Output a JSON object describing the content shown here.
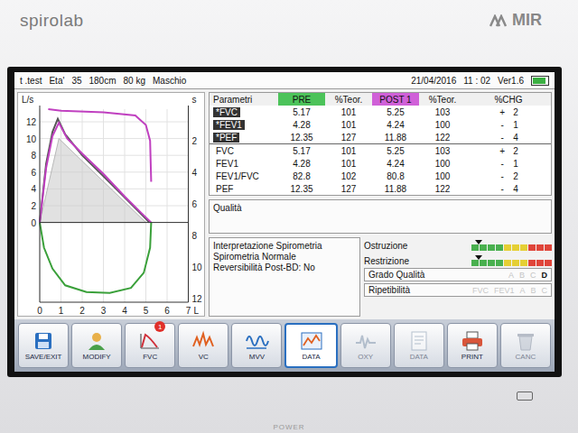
{
  "device": {
    "brand": "spirolab",
    "logo": "MIR",
    "power_label": "POWER"
  },
  "header": {
    "patient": "t .test",
    "age_label": "Eta'",
    "age": "35",
    "height": "180cm",
    "weight": "80 kg",
    "sex": "Maschio",
    "date": "21/04/2016",
    "time": "11 : 02",
    "version": "Ver1.6",
    "battery_level": 0.9
  },
  "chart": {
    "flow_unit": "L/s",
    "time_unit": "s",
    "volume_unit": "L",
    "flow_ticks": [
      "12",
      "10",
      "8",
      "6",
      "4",
      "2",
      "0"
    ],
    "time_ticks": [
      "2",
      "4",
      "6",
      "8",
      "10",
      "12"
    ],
    "volume_ticks": [
      "0",
      "1",
      "2",
      "3",
      "4",
      "5",
      "6",
      "7"
    ],
    "series": [
      {
        "kind": "area",
        "axis": "flow",
        "color": "#c9c9c9",
        "points": [
          [
            0,
            0
          ],
          [
            0.9,
            10
          ],
          [
            5,
            0
          ]
        ]
      },
      {
        "kind": "line",
        "axis": "flow",
        "color": "#555555",
        "points": [
          [
            0,
            0
          ],
          [
            0.3,
            7
          ],
          [
            0.6,
            10.8
          ],
          [
            0.85,
            12.35
          ],
          [
            1.2,
            10.5
          ],
          [
            2,
            8
          ],
          [
            3,
            5.5
          ],
          [
            4,
            3
          ],
          [
            4.7,
            1.2
          ],
          [
            5.17,
            0
          ]
        ]
      },
      {
        "kind": "line",
        "axis": "flow",
        "color": "#c040c0",
        "points": [
          [
            0,
            0
          ],
          [
            0.3,
            6.5
          ],
          [
            0.6,
            10.3
          ],
          [
            0.9,
            11.88
          ],
          [
            1.3,
            10
          ],
          [
            2,
            8.2
          ],
          [
            3,
            5.8
          ],
          [
            4,
            3.1
          ],
          [
            4.8,
            1.1
          ],
          [
            5.25,
            0
          ]
        ]
      },
      {
        "kind": "line",
        "axis": "flow",
        "color": "#3aa03a",
        "points": [
          [
            5.25,
            0
          ],
          [
            5.2,
            -3
          ],
          [
            4.9,
            -6
          ],
          [
            4.3,
            -7.8
          ],
          [
            3.3,
            -8.4
          ],
          [
            2.2,
            -8.3
          ],
          [
            1.2,
            -7.5
          ],
          [
            0.6,
            -5.5
          ],
          [
            0.2,
            -3
          ],
          [
            0,
            0
          ]
        ]
      },
      {
        "kind": "line",
        "axis": "time",
        "color": "#c040c0",
        "points": [
          [
            0.4,
            0
          ],
          [
            1,
            0.1
          ],
          [
            3,
            0.2
          ],
          [
            4.5,
            0.4
          ],
          [
            5,
            1
          ],
          [
            5.2,
            2
          ],
          [
            5.25,
            4.6
          ]
        ]
      }
    ]
  },
  "table": {
    "columns": [
      {
        "label": "Parametri",
        "color": ""
      },
      {
        "label": "PRE",
        "color": "#4cc35a"
      },
      {
        "label": "%Teor.",
        "color": ""
      },
      {
        "label": "POST 1",
        "color": "#d060d8"
      },
      {
        "label": "%Teor.",
        "color": ""
      },
      {
        "label": "%CHG",
        "color": ""
      }
    ],
    "rows": [
      {
        "param": "*FVC",
        "highlighted": true,
        "pre": "5.17",
        "pre_pct": "101",
        "post": "5.25",
        "post_pct": "103",
        "sign": "+",
        "chg": "2"
      },
      {
        "param": "*FEV1",
        "highlighted": true,
        "pre": "4.28",
        "pre_pct": "101",
        "post": "4.24",
        "post_pct": "100",
        "sign": "-",
        "chg": "1"
      },
      {
        "param": "*PEF",
        "highlighted": true,
        "pre": "12.35",
        "pre_pct": "127",
        "post": "11.88",
        "post_pct": "122",
        "sign": "-",
        "chg": "4"
      },
      {
        "param": "FVC",
        "highlighted": false,
        "pre": "5.17",
        "pre_pct": "101",
        "post": "5.25",
        "post_pct": "103",
        "sign": "+",
        "chg": "2"
      },
      {
        "param": "FEV1",
        "highlighted": false,
        "pre": "4.28",
        "pre_pct": "101",
        "post": "4.24",
        "post_pct": "100",
        "sign": "-",
        "chg": "1"
      },
      {
        "param": "FEV1/FVC",
        "highlighted": false,
        "pre": "82.8",
        "pre_pct": "102",
        "post": "80.8",
        "post_pct": "100",
        "sign": "-",
        "chg": "2"
      },
      {
        "param": "PEF",
        "highlighted": false,
        "pre": "12.35",
        "pre_pct": "127",
        "post": "11.88",
        "post_pct": "122",
        "sign": "-",
        "chg": "4"
      }
    ]
  },
  "quality": {
    "label": "Qualità",
    "text": ""
  },
  "interpretation": {
    "title": "Interpretazione Spirometria",
    "result": "Spirometria Normale",
    "reversibility": "Reversibilità Post-BD: No"
  },
  "meters": [
    {
      "label": "Ostruzione",
      "level": 0.05
    },
    {
      "label": "Restrizione",
      "level": 0.05
    }
  ],
  "grade": {
    "label": "Grado Qualità",
    "grades": [
      {
        "label": "A",
        "selected": false
      },
      {
        "label": "B",
        "selected": false
      },
      {
        "label": "C",
        "selected": false
      },
      {
        "label": "D",
        "selected": true
      }
    ]
  },
  "repeatability": {
    "label": "Ripetibilità",
    "items": [
      "FVC",
      "FEV1",
      "A",
      "B",
      "C"
    ]
  },
  "toolbar": [
    {
      "label": "SAVE/EXIT",
      "kind": "save",
      "selected": false,
      "disabled": false,
      "badge": ""
    },
    {
      "label": "MODIFY",
      "kind": "modify",
      "selected": false,
      "disabled": false,
      "badge": ""
    },
    {
      "label": "FVC",
      "kind": "fvc",
      "selected": false,
      "disabled": false,
      "badge": "1"
    },
    {
      "label": "VC",
      "kind": "vc",
      "selected": false,
      "disabled": false,
      "badge": ""
    },
    {
      "label": "MVV",
      "kind": "mvv",
      "selected": false,
      "disabled": false,
      "badge": ""
    },
    {
      "label": "DATA",
      "kind": "data",
      "selected": true,
      "disabled": false,
      "badge": ""
    },
    {
      "label": "OXY",
      "kind": "oxy",
      "selected": false,
      "disabled": true,
      "badge": ""
    },
    {
      "label": "DATA",
      "kind": "doc",
      "selected": false,
      "disabled": true,
      "badge": ""
    },
    {
      "label": "PRINT",
      "kind": "print",
      "selected": false,
      "disabled": false,
      "badge": ""
    },
    {
      "label": "CANC",
      "kind": "canc",
      "selected": false,
      "disabled": true,
      "badge": ""
    }
  ]
}
